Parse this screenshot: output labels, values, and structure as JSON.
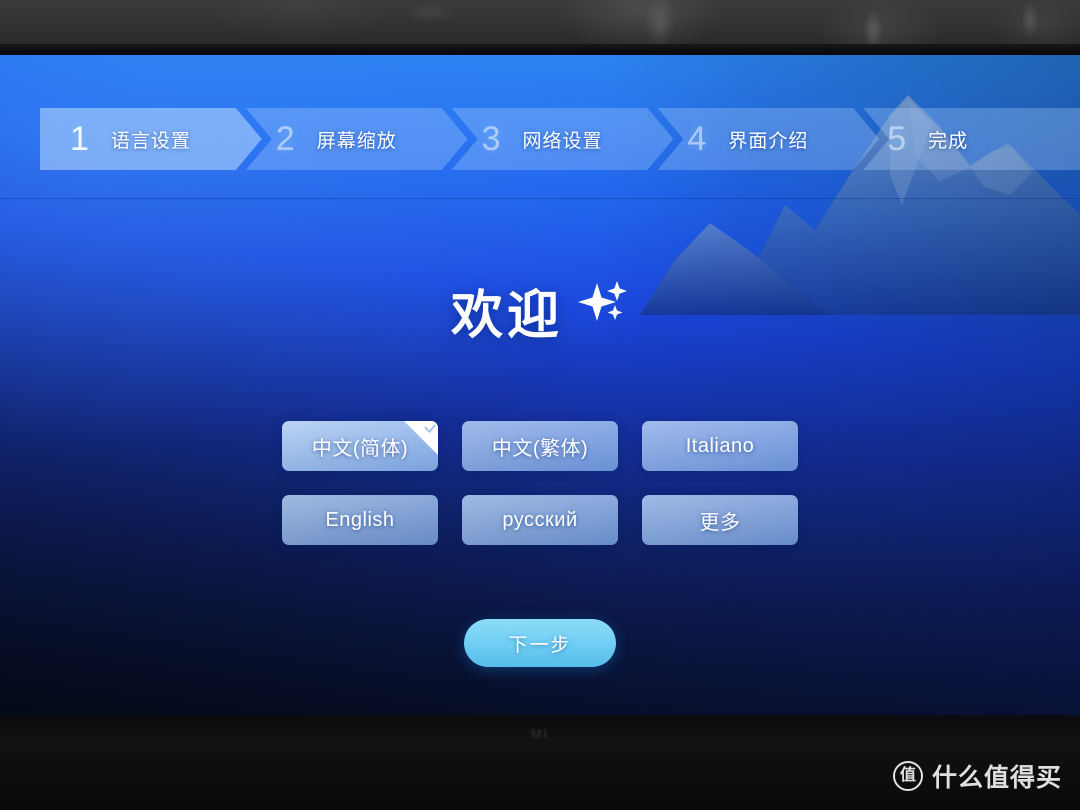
{
  "device": {
    "brand_logo": "MI"
  },
  "stepbar": {
    "steps": [
      {
        "num": "1",
        "label": "语言设置",
        "active": true
      },
      {
        "num": "2",
        "label": "屏幕缩放",
        "active": false
      },
      {
        "num": "3",
        "label": "网络设置",
        "active": false
      },
      {
        "num": "4",
        "label": "界面介绍",
        "active": false
      },
      {
        "num": "5",
        "label": "完成",
        "active": false
      }
    ]
  },
  "main": {
    "welcome_title": "欢迎",
    "welcome_icon": "sparkle-icon",
    "languages": [
      {
        "label": "中文(简体)",
        "selected": true
      },
      {
        "label": "中文(繁体)",
        "selected": false
      },
      {
        "label": "Italiano",
        "selected": false
      },
      {
        "label": "English",
        "selected": false
      },
      {
        "label": "русский",
        "selected": false
      },
      {
        "label": "更多",
        "selected": false
      }
    ],
    "next_button": "下一步"
  },
  "watermark": {
    "badge": "值",
    "text": "什么值得买"
  },
  "colors": {
    "panel_top_blue": "#2b8bf0",
    "panel_mid_blue": "#1a46de",
    "panel_bottom_navy": "#050a18",
    "button_fill": "#c4dfff",
    "next_button_fill": "#6ecdf3",
    "text_white": "#ffffff"
  }
}
